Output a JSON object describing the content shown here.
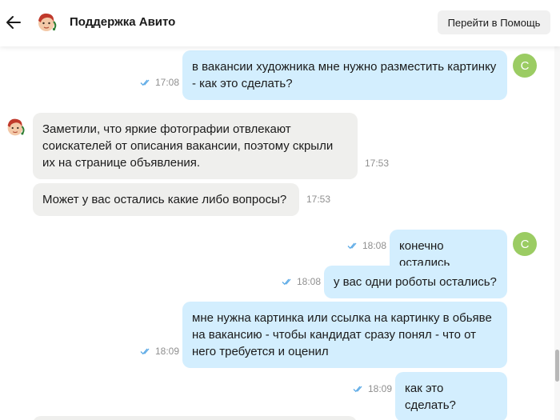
{
  "header": {
    "title": "Поддержка Авито",
    "help_button": "Перейти в Помощь"
  },
  "user": {
    "initial": "С"
  },
  "colors": {
    "outgoing_bubble": "#d3eefe",
    "incoming_bubble": "#efefed",
    "user_avatar": "#9bcc63",
    "read_ticks": "#5aa9e6"
  },
  "messages": [
    {
      "direction": "out",
      "text": "в вакансии художника мне нужно разместить картинку - как это сделать?",
      "time": "17:08"
    },
    {
      "direction": "in",
      "text": "Заметили, что яркие фотографии отвлекают соискателей от описания вакансии, поэтому скрыли их на странице объявления.",
      "time": "17:53"
    },
    {
      "direction": "in",
      "text": "Может у вас остались какие либо вопросы?",
      "time": "17:53"
    },
    {
      "direction": "out",
      "text": "конечно остались",
      "time": "18:08"
    },
    {
      "direction": "out",
      "text": "у вас одни роботы остались?",
      "time": "18:08"
    },
    {
      "direction": "out",
      "text": "мне нужна картинка или ссылка на картинку в обьяве на вакансию - чтобы кандидат сразу понял - что от него требуется и оценил",
      "time": "18:09"
    },
    {
      "direction": "out",
      "text": "как это сделать?",
      "time": "18:09"
    }
  ]
}
